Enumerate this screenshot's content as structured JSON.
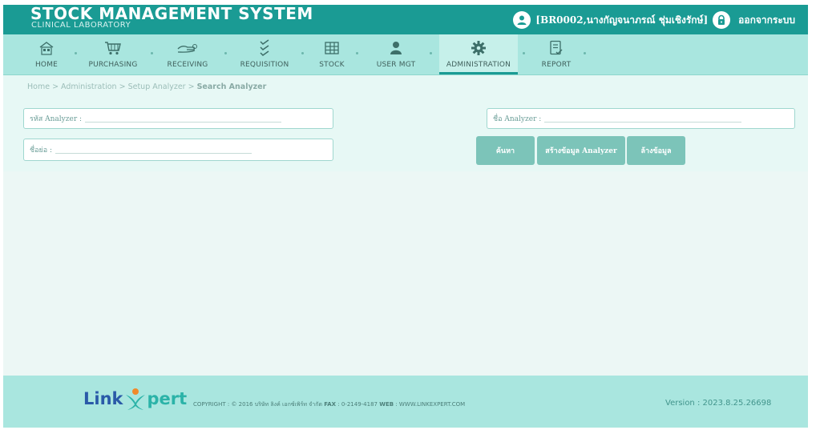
{
  "header": {
    "title": "STOCK MANAGEMENT SYSTEM",
    "subtitle": "CLINICAL LABORATORY",
    "user_label": "[BR0002,นางกัญจนาภรณ์ ชุ่มเชิงรักษ์]",
    "logout_label": "ออกจากระบบ",
    "user_icon": "user-icon",
    "lock_icon": "lock-icon"
  },
  "nav": {
    "items": [
      {
        "label": "HOME",
        "icon": "home-icon"
      },
      {
        "label": "PURCHASING",
        "icon": "cart-icon"
      },
      {
        "label": "RECEIVING",
        "icon": "hand-icon"
      },
      {
        "label": "REQUISITION",
        "icon": "checklist-icon"
      },
      {
        "label": "STOCK",
        "icon": "grid-icon"
      },
      {
        "label": "USER MGT",
        "icon": "person-icon"
      },
      {
        "label": "ADMINISTRATION",
        "icon": "gear-icon"
      },
      {
        "label": "REPORT",
        "icon": "report-icon"
      }
    ],
    "active": "ADMINISTRATION"
  },
  "breadcrumb": {
    "prefix": "Home > Administration > Setup Analyzer > ",
    "current": "Search Analyzer"
  },
  "form": {
    "analyzer_code_label": "รหัส Analyzer :",
    "analyzer_name_label": "ชื่อ Analyzer :",
    "short_name_label": "ชื่อย่อ :",
    "analyzer_code_value": "",
    "analyzer_name_value": "",
    "short_name_value": ""
  },
  "buttons": {
    "search": "ค้นหา",
    "create": "สร้างข้อมูล Analyzer",
    "clear": "ล้างข้อมูล"
  },
  "footer": {
    "logo_link": "Link",
    "logo_pert": "pert",
    "copyright_prefix": "COPYRIGHT : © 2016 บริษัท ลิงค์ เอกซ์เพิร์ท จำกัด",
    "fax_label": "FAX",
    "fax_value": ": 0-2149-4187",
    "web_label": "WEB",
    "web_value": ": WWW.LINKEXPERT.COM",
    "version": "Version : 2023.8.25.26698"
  },
  "colors": {
    "header_bg": "#1a9b94",
    "nav_bg": "#a9e6df",
    "content_bg": "#e7f8f5",
    "button_bg": "#7cc4b9",
    "logo_blue": "#2a5aa8",
    "logo_teal": "#2bb3a8",
    "logo_orange": "#f08a2b"
  }
}
